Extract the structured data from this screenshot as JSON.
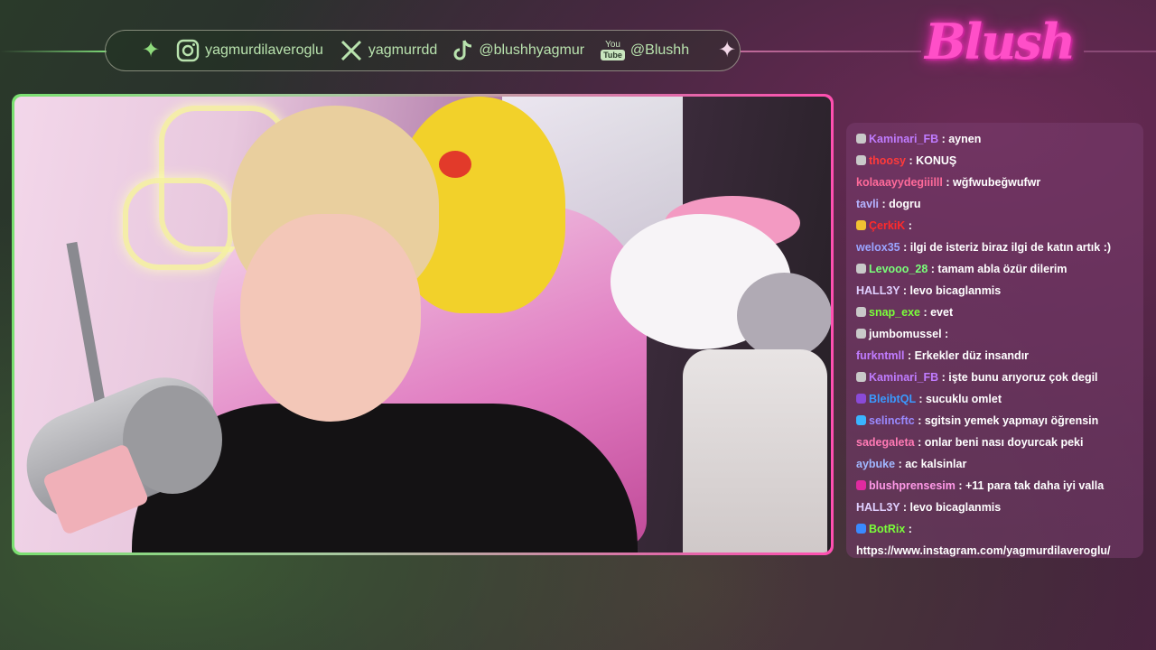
{
  "social_bar": {
    "instagram": "yagmurdilaveroglu",
    "x": "yagmurrdd",
    "tiktok": "@blushhyagmur",
    "youtube_top": "You",
    "youtube_box": "Tube",
    "youtube": "@Blushh"
  },
  "logo": {
    "text": "Blush"
  },
  "colors": {
    "accent_green": "#7ae070",
    "accent_pink": "#ff4fb0",
    "logo": "#ff4fc8"
  },
  "chat": {
    "messages": [
      {
        "user": "Kaminari_FB",
        "color": "#c07cff",
        "badge": "#c9c9c9",
        "text": ": aynen"
      },
      {
        "user": "thoosy",
        "color": "#ff3a3a",
        "badge": "#c9c9c9",
        "text": ": KONUŞ"
      },
      {
        "user": "kolaaayydegiiilll",
        "color": "#ff6a9a",
        "text": ": wğfwubeğwufwr"
      },
      {
        "user": "tavli",
        "color": "#b4b4ff",
        "text": ": dogru"
      },
      {
        "user": "ÇerkiK",
        "color": "#ff2a2a",
        "badge": "#f1c232",
        "text": ":"
      },
      {
        "user": "welox35",
        "color": "#9aa4ff",
        "text": ": ilgi de isteriz biraz ilgi de katın artık :)"
      },
      {
        "user": "Levooo_28",
        "color": "#7aff7a",
        "badge": "#c9c9c9",
        "text": ": tamam abla özür dilerim"
      },
      {
        "user": "HALL3Y",
        "color": "#e0d0ff",
        "text": ": levo bicaglanmis"
      },
      {
        "user": "snap_exe",
        "color": "#7aff3a",
        "badge": "#c9c9c9",
        "text": ": evet"
      },
      {
        "user": "jumbomussel",
        "color": "#ffffff",
        "badge": "#c9c9c9",
        "text": ":"
      },
      {
        "user": "furkntmll",
        "color": "#c07cff",
        "text": ": Erkekler düz insandır"
      },
      {
        "user": "Kaminari_FB",
        "color": "#c07cff",
        "badge": "#c9c9c9",
        "text": ": işte bunu arıyoruz çok degil"
      },
      {
        "user": "BleibtQL",
        "color": "#3a9aff",
        "badge": "#8a4ad8",
        "text": ": sucuklu omlet"
      },
      {
        "user": "selincftc",
        "color": "#9a8aff",
        "badge": "#3ab4ff",
        "text": ": sgitsin yemek yapmayı öğrensin"
      },
      {
        "user": "sadegaleta",
        "color": "#ff7ab4",
        "text": ": onlar beni nası doyurcak peki"
      },
      {
        "user": "aybuke",
        "color": "#a0b8ff",
        "text": ": ac kalsinlar"
      },
      {
        "user": "blushprensesim",
        "color": "#ff9ae8",
        "badge": "#e02aa0",
        "text": ": +11 para tak daha iyi valla"
      },
      {
        "user": "HALL3Y",
        "color": "#e0d0ff",
        "text": ": levo bicaglanmis"
      },
      {
        "user": "BotRix",
        "color": "#7aff3a",
        "badge": "#3a8aff",
        "text": ":"
      }
    ],
    "last_line": "https://www.instagram.com/yagmurdilaveroglu/"
  }
}
